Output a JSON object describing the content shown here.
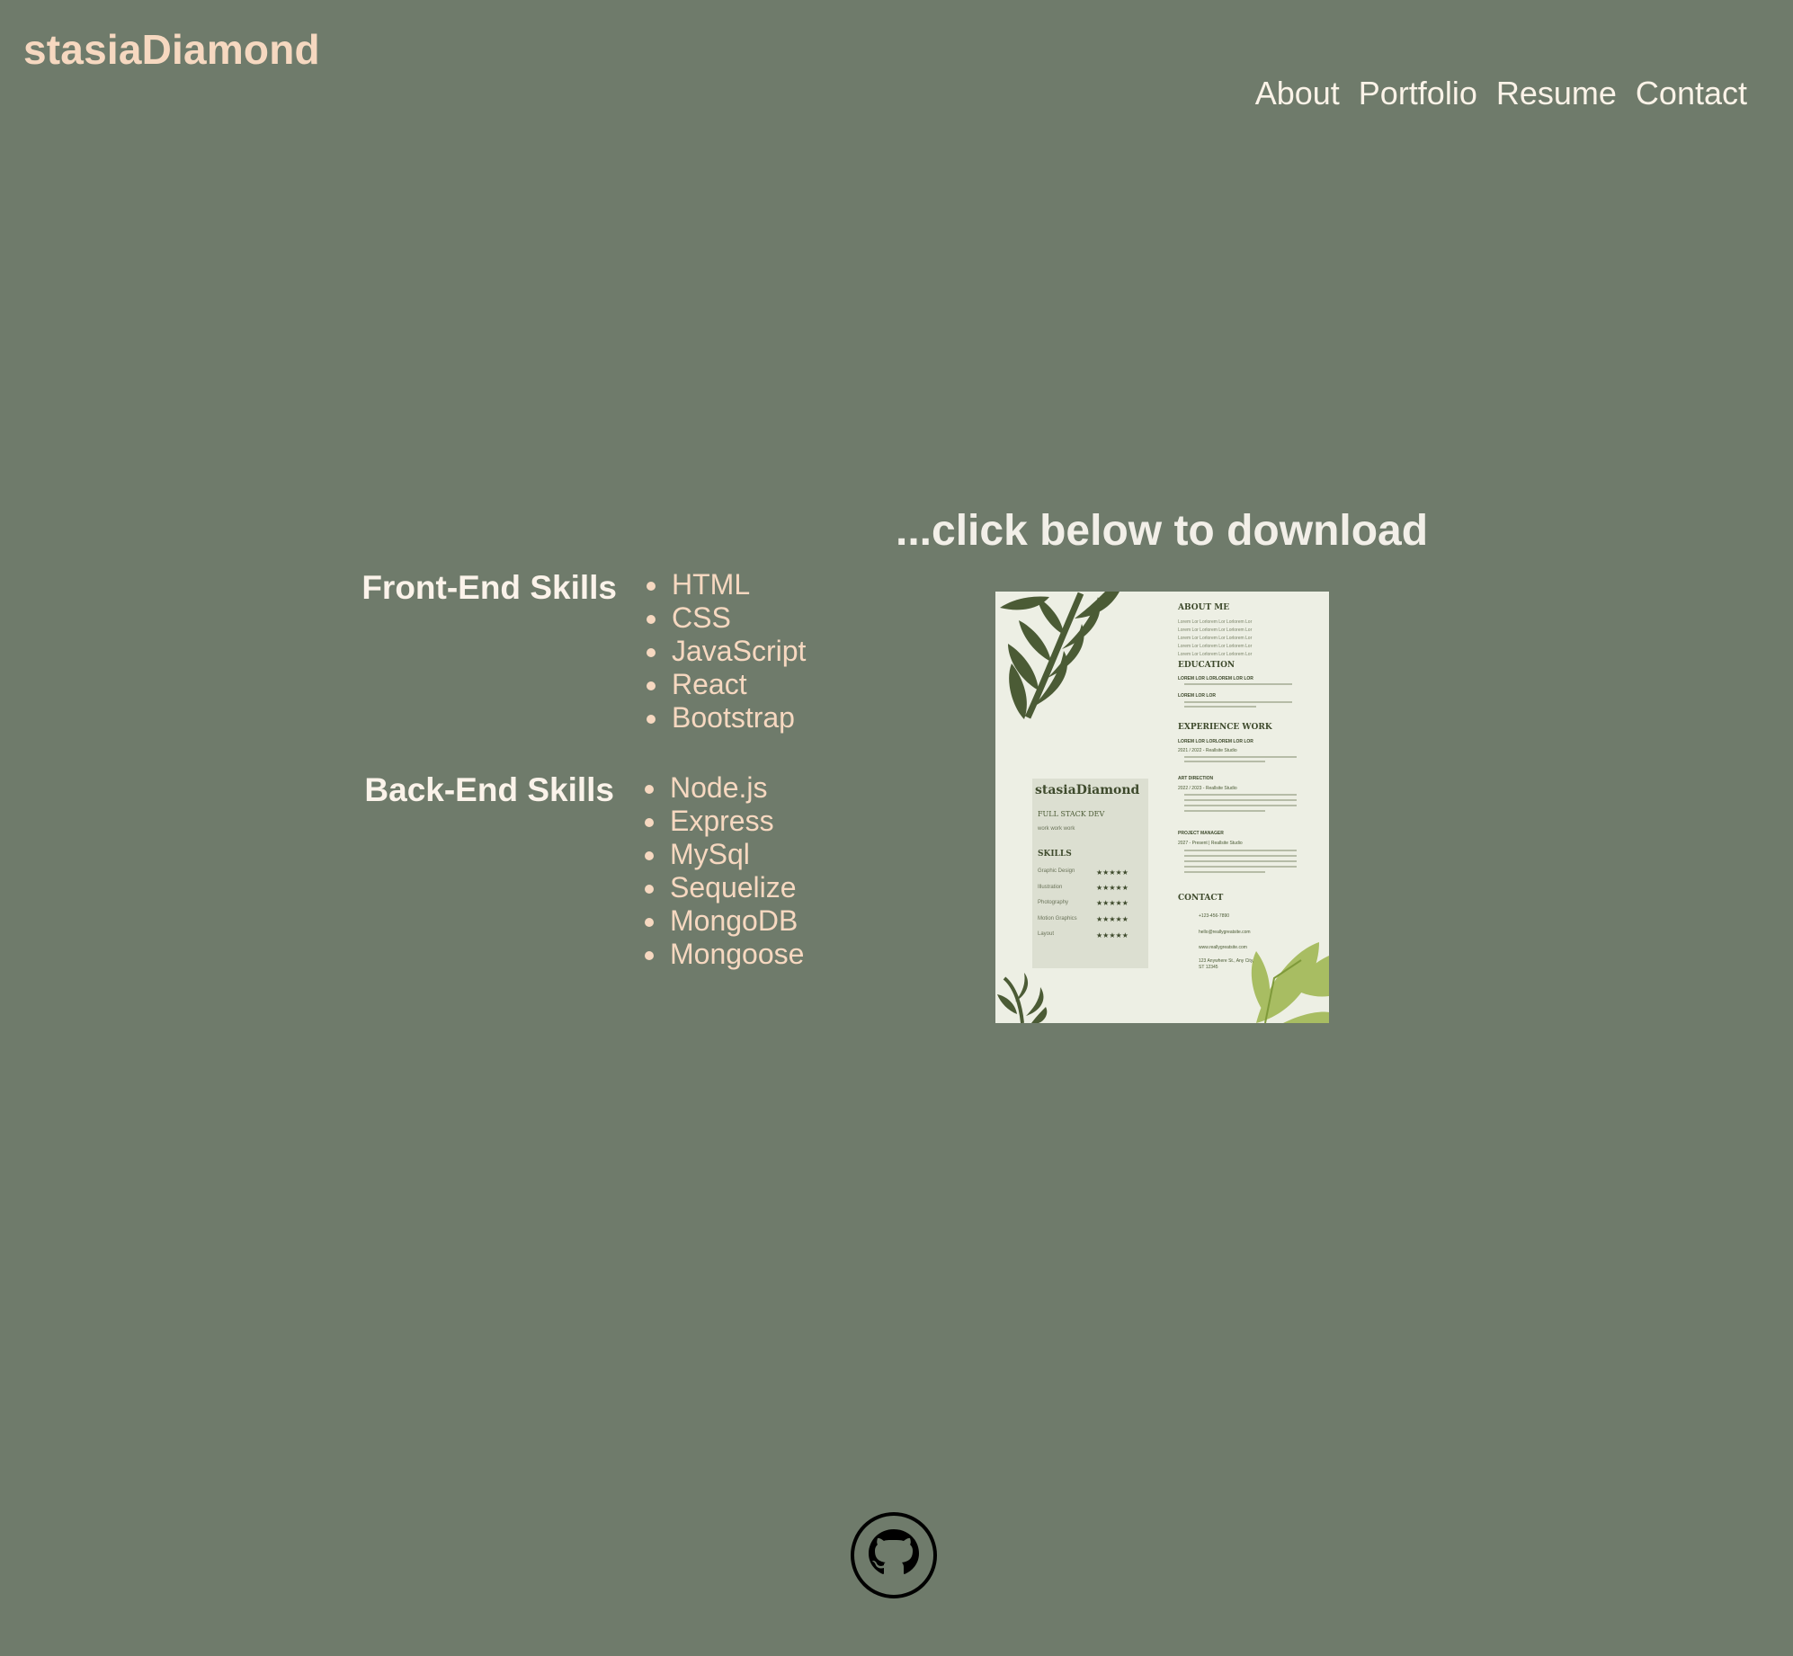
{
  "brand": "stasiaDiamond",
  "nav": {
    "about": "About",
    "portfolio": "Portfolio",
    "resume": "Resume",
    "contact": "Contact"
  },
  "download_heading": "...click below to download",
  "skills": {
    "front_label": "Front-End Skills",
    "front": [
      "HTML",
      "CSS",
      "JavaScript",
      "React",
      "Bootstrap"
    ],
    "back_label": "Back-End Skills",
    "back": [
      "Node.js",
      "Express",
      "MySql",
      "Sequelize",
      "MongoDB",
      "Mongoose"
    ]
  },
  "resume_preview": {
    "name": "stasiaDiamond",
    "role": "FULL STACK DEV",
    "subtitle": "work work work",
    "skills_heading": "SKILLS",
    "skills": [
      "Graphic Design",
      "Illustration",
      "Photography",
      "Motion Graphics",
      "Layout"
    ],
    "about_heading": "ABOUT ME",
    "about_text": "Lorem Lor Lorlorem Lor Lorlorem Lor",
    "education_heading": "EDUCATION",
    "education_line1": "LOREM LOR LORLOREM LOR LOR",
    "education_line2": "LOREM LOR LOR",
    "experience_heading": "EXPERIENCE WORK",
    "experience_line1": "LOREM LOR LORLOREM LOR LOR",
    "experience_date1": "2021 / 2022 - Reallsite Studio",
    "experience_role2": "ART DIRECTION",
    "experience_date2": "2022 / 2023 - Reallsite Studio",
    "experience_role3": "PROJECT MANAGER",
    "experience_date3": "2027 - Present | Reallsite Studio",
    "contact_heading": "CONTACT",
    "phone": "+123-456-7890",
    "email": "hello@reallygreatsite.com",
    "website": "www.reallygreatsite.com",
    "address1": "123 Anywhere St., Any City,",
    "address2": "ST 12345"
  },
  "colors": {
    "background": "#6f7b6b",
    "accent": "#f6d8c0",
    "heading": "#fbf3ea",
    "resume_paper": "#edefe4",
    "resume_dark_green": "#4b5b35",
    "resume_light_green": "#a8bd62"
  },
  "icons": {
    "github": "github-octocat-icon"
  }
}
